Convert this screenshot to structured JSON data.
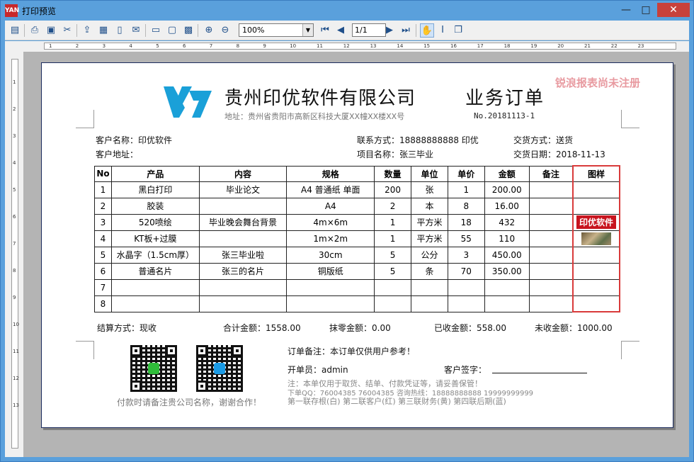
{
  "window": {
    "title": "打印预览",
    "app_icon_text": "YAN",
    "min": "—",
    "max": "□",
    "close": "✕"
  },
  "toolbar": {
    "zoom": "100%",
    "page": "1/1",
    "icons": [
      "contents-icon",
      "print-icon",
      "book-icon",
      "tools-icon",
      "export-icon",
      "excel-icon",
      "pdf-icon",
      "mail-icon",
      "layout-icon",
      "page-icon",
      "grid-icon",
      "zoom-in-icon",
      "zoom-out-icon",
      "first-page-icon",
      "prev-page-icon",
      "next-page-icon",
      "last-page-icon",
      "hand-icon",
      "text-cursor-icon",
      "copy-icon"
    ]
  },
  "ruler": {
    "h": [
      "1",
      "2",
      "3",
      "4",
      "5",
      "6",
      "7",
      "8",
      "9",
      "10",
      "11",
      "12",
      "13",
      "14",
      "15",
      "16",
      "17",
      "18",
      "19",
      "20",
      "21",
      "22",
      "23"
    ],
    "v": [
      "1",
      "2",
      "3",
      "4",
      "5",
      "6",
      "7",
      "8",
      "9",
      "10",
      "11",
      "12",
      "13"
    ]
  },
  "report": {
    "watermark": "锐浪报表尚未注册",
    "company": "贵州印优软件有限公司",
    "title": "业务订单",
    "address": "地址：贵州省贵阳市高新区科技大厦XX幢XX楼XX号",
    "order_no": "No.20181113-1",
    "customer_name": "客户名称：印优软件",
    "contact": "联系方式：18888888888 印优",
    "delivery_method": "交货方式：送货",
    "customer_address": "客户地址：",
    "project": "项目名称：张三毕业",
    "delivery_date": "交货日期：2018-11-13",
    "columns": [
      "No",
      "产品",
      "内容",
      "规格",
      "数量",
      "单位",
      "单价",
      "金额",
      "备注",
      "图样"
    ],
    "rows": [
      [
        "1",
        "黑白打印",
        "毕业论文",
        "A4 普通纸 单面",
        "200",
        "张",
        "1",
        "200.00",
        "",
        ""
      ],
      [
        "2",
        "胶装",
        "",
        "A4",
        "2",
        "本",
        "8",
        "16.00",
        "",
        ""
      ],
      [
        "3",
        "520喷绘",
        "毕业晚会舞台背景",
        "4m×6m",
        "1",
        "平方米",
        "18",
        "432",
        "",
        "印优软件"
      ],
      [
        "4",
        "KT板+过膜",
        "",
        "1m×2m",
        "1",
        "平方米",
        "55",
        "110",
        "",
        ""
      ],
      [
        "5",
        "水晶字（1.5cm厚）",
        "张三毕业啦",
        "30cm",
        "5",
        "公分",
        "3",
        "450.00",
        "",
        ""
      ],
      [
        "6",
        "普通名片",
        "张三的名片",
        "铜版纸",
        "5",
        "条",
        "70",
        "350.00",
        "",
        ""
      ],
      [
        "7",
        "",
        "",
        "",
        "",
        "",
        "",
        "",
        "",
        ""
      ],
      [
        "8",
        "",
        "",
        "",
        "",
        "",
        "",
        "",
        "",
        ""
      ]
    ],
    "settlement": "结算方式：现收",
    "total": "合计金额：1558.00",
    "discount": "抹零金额：0.00",
    "received": "已收金额：558.00",
    "unreceived": "未收金额：1000.00",
    "qr_caption": "付款时请备注贵公司名称，谢谢合作！",
    "order_note": "订单备注：本订单仅供用户参考！",
    "operator": "开单员：admin",
    "customer_sign": "客户签字：",
    "note_line1": "注：本单仅用于取货、结单、付款凭证等，请妥善保管！",
    "note_line2": "下单QQ：76004385    76004385        咨询热线：18888888888    19999999999",
    "note_line3": "第一联存根(白)   第二联客户(红)    第三联财务(黄)    第四联后期(蓝)",
    "colors": {
      "brand": "#1aa0d8",
      "badge": "#c8141e",
      "highlight": "#d93a3a"
    }
  }
}
